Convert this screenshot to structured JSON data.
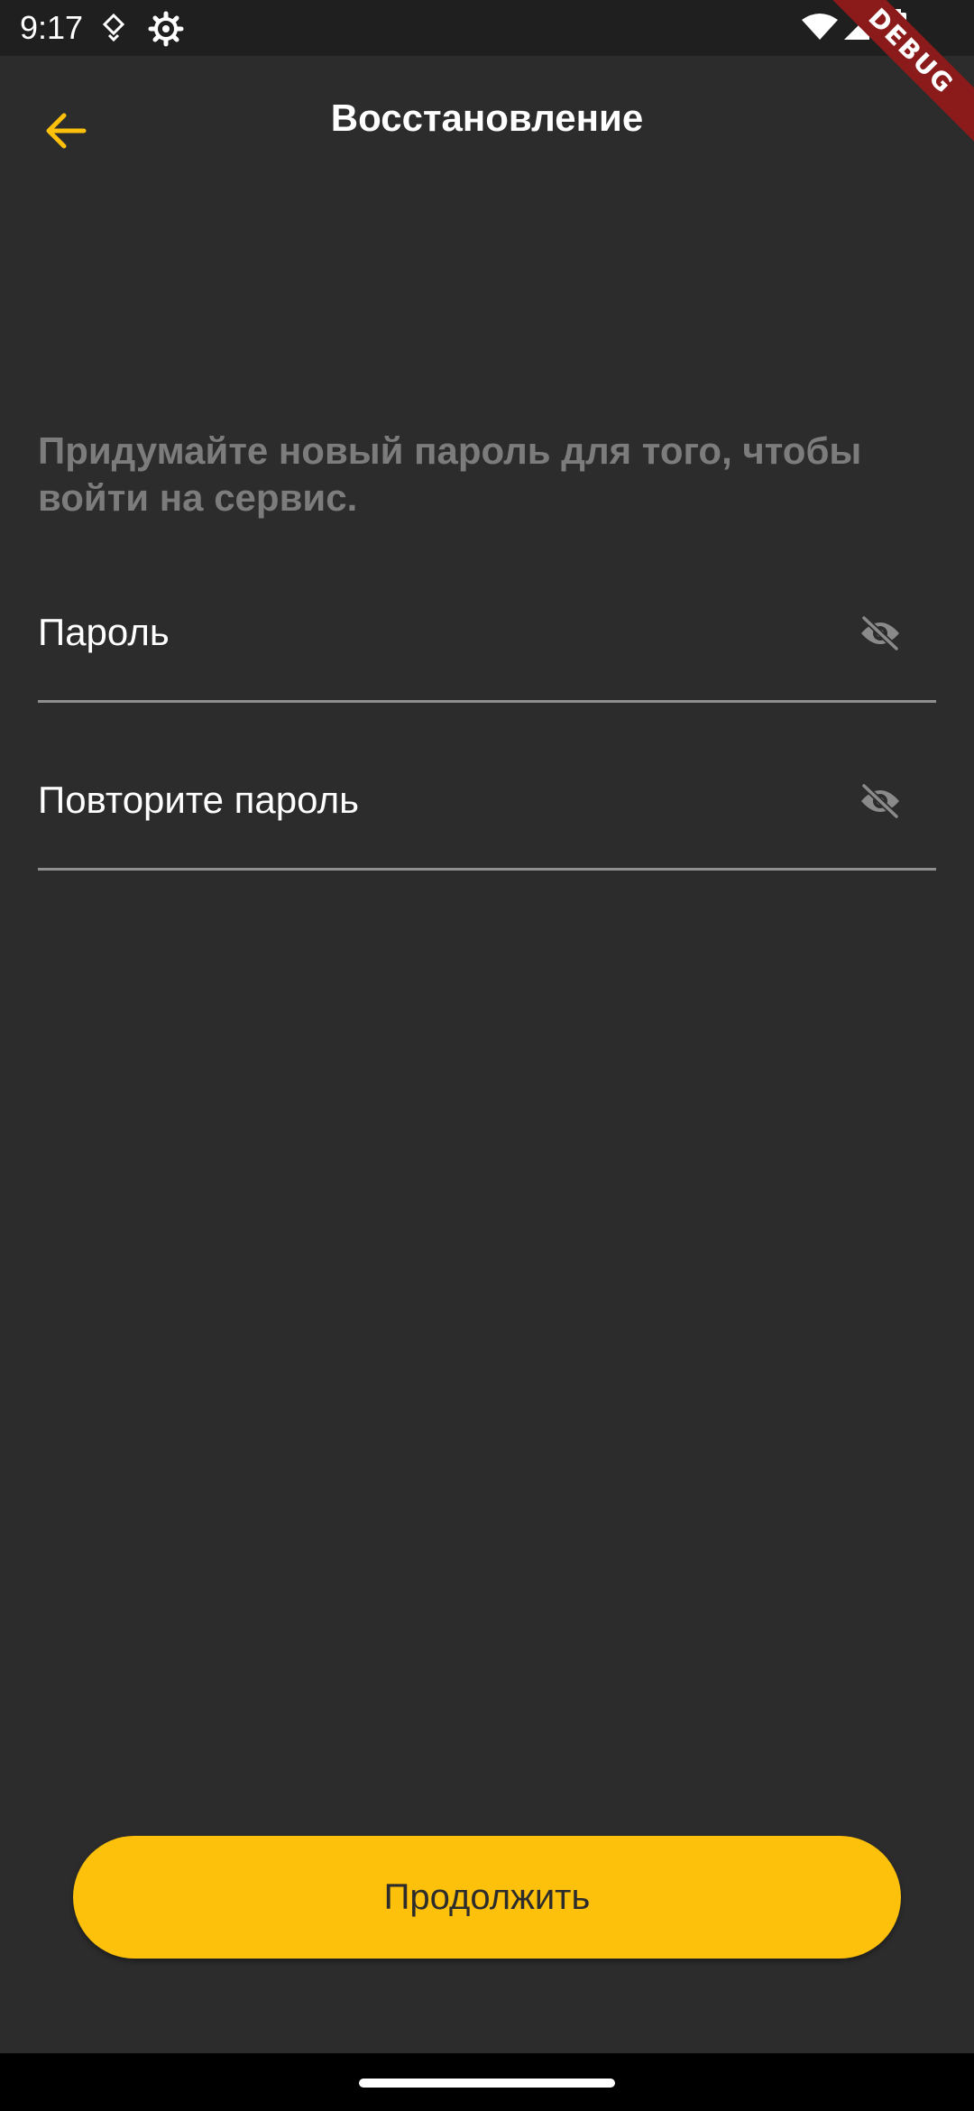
{
  "status_bar": {
    "time": "9:17",
    "icons": [
      "location-pin-icon",
      "settings-gear-icon",
      "wifi-icon",
      "signal-icon",
      "battery-icon"
    ]
  },
  "debug_banner": "DEBUG",
  "app_bar": {
    "title": "Восстановление",
    "back_icon": "arrow-back-icon"
  },
  "instruction": "Придумайте новый пароль для того, чтобы войти на сервис.",
  "form": {
    "password": {
      "label": "Пароль",
      "value": "",
      "toggle_icon": "eye-off-icon"
    },
    "repeat_password": {
      "label": "Повторите пароль",
      "value": "",
      "toggle_icon": "eye-off-icon"
    }
  },
  "continue_button": {
    "label": "Продолжить"
  },
  "colors": {
    "background": "#2c2c2c",
    "accent": "#fec10b",
    "status_bar": "#1f1f1f",
    "instruction_text": "#7c7c7c",
    "divider": "#8f8f8f",
    "debug_ribbon": "#8b1a1a"
  }
}
